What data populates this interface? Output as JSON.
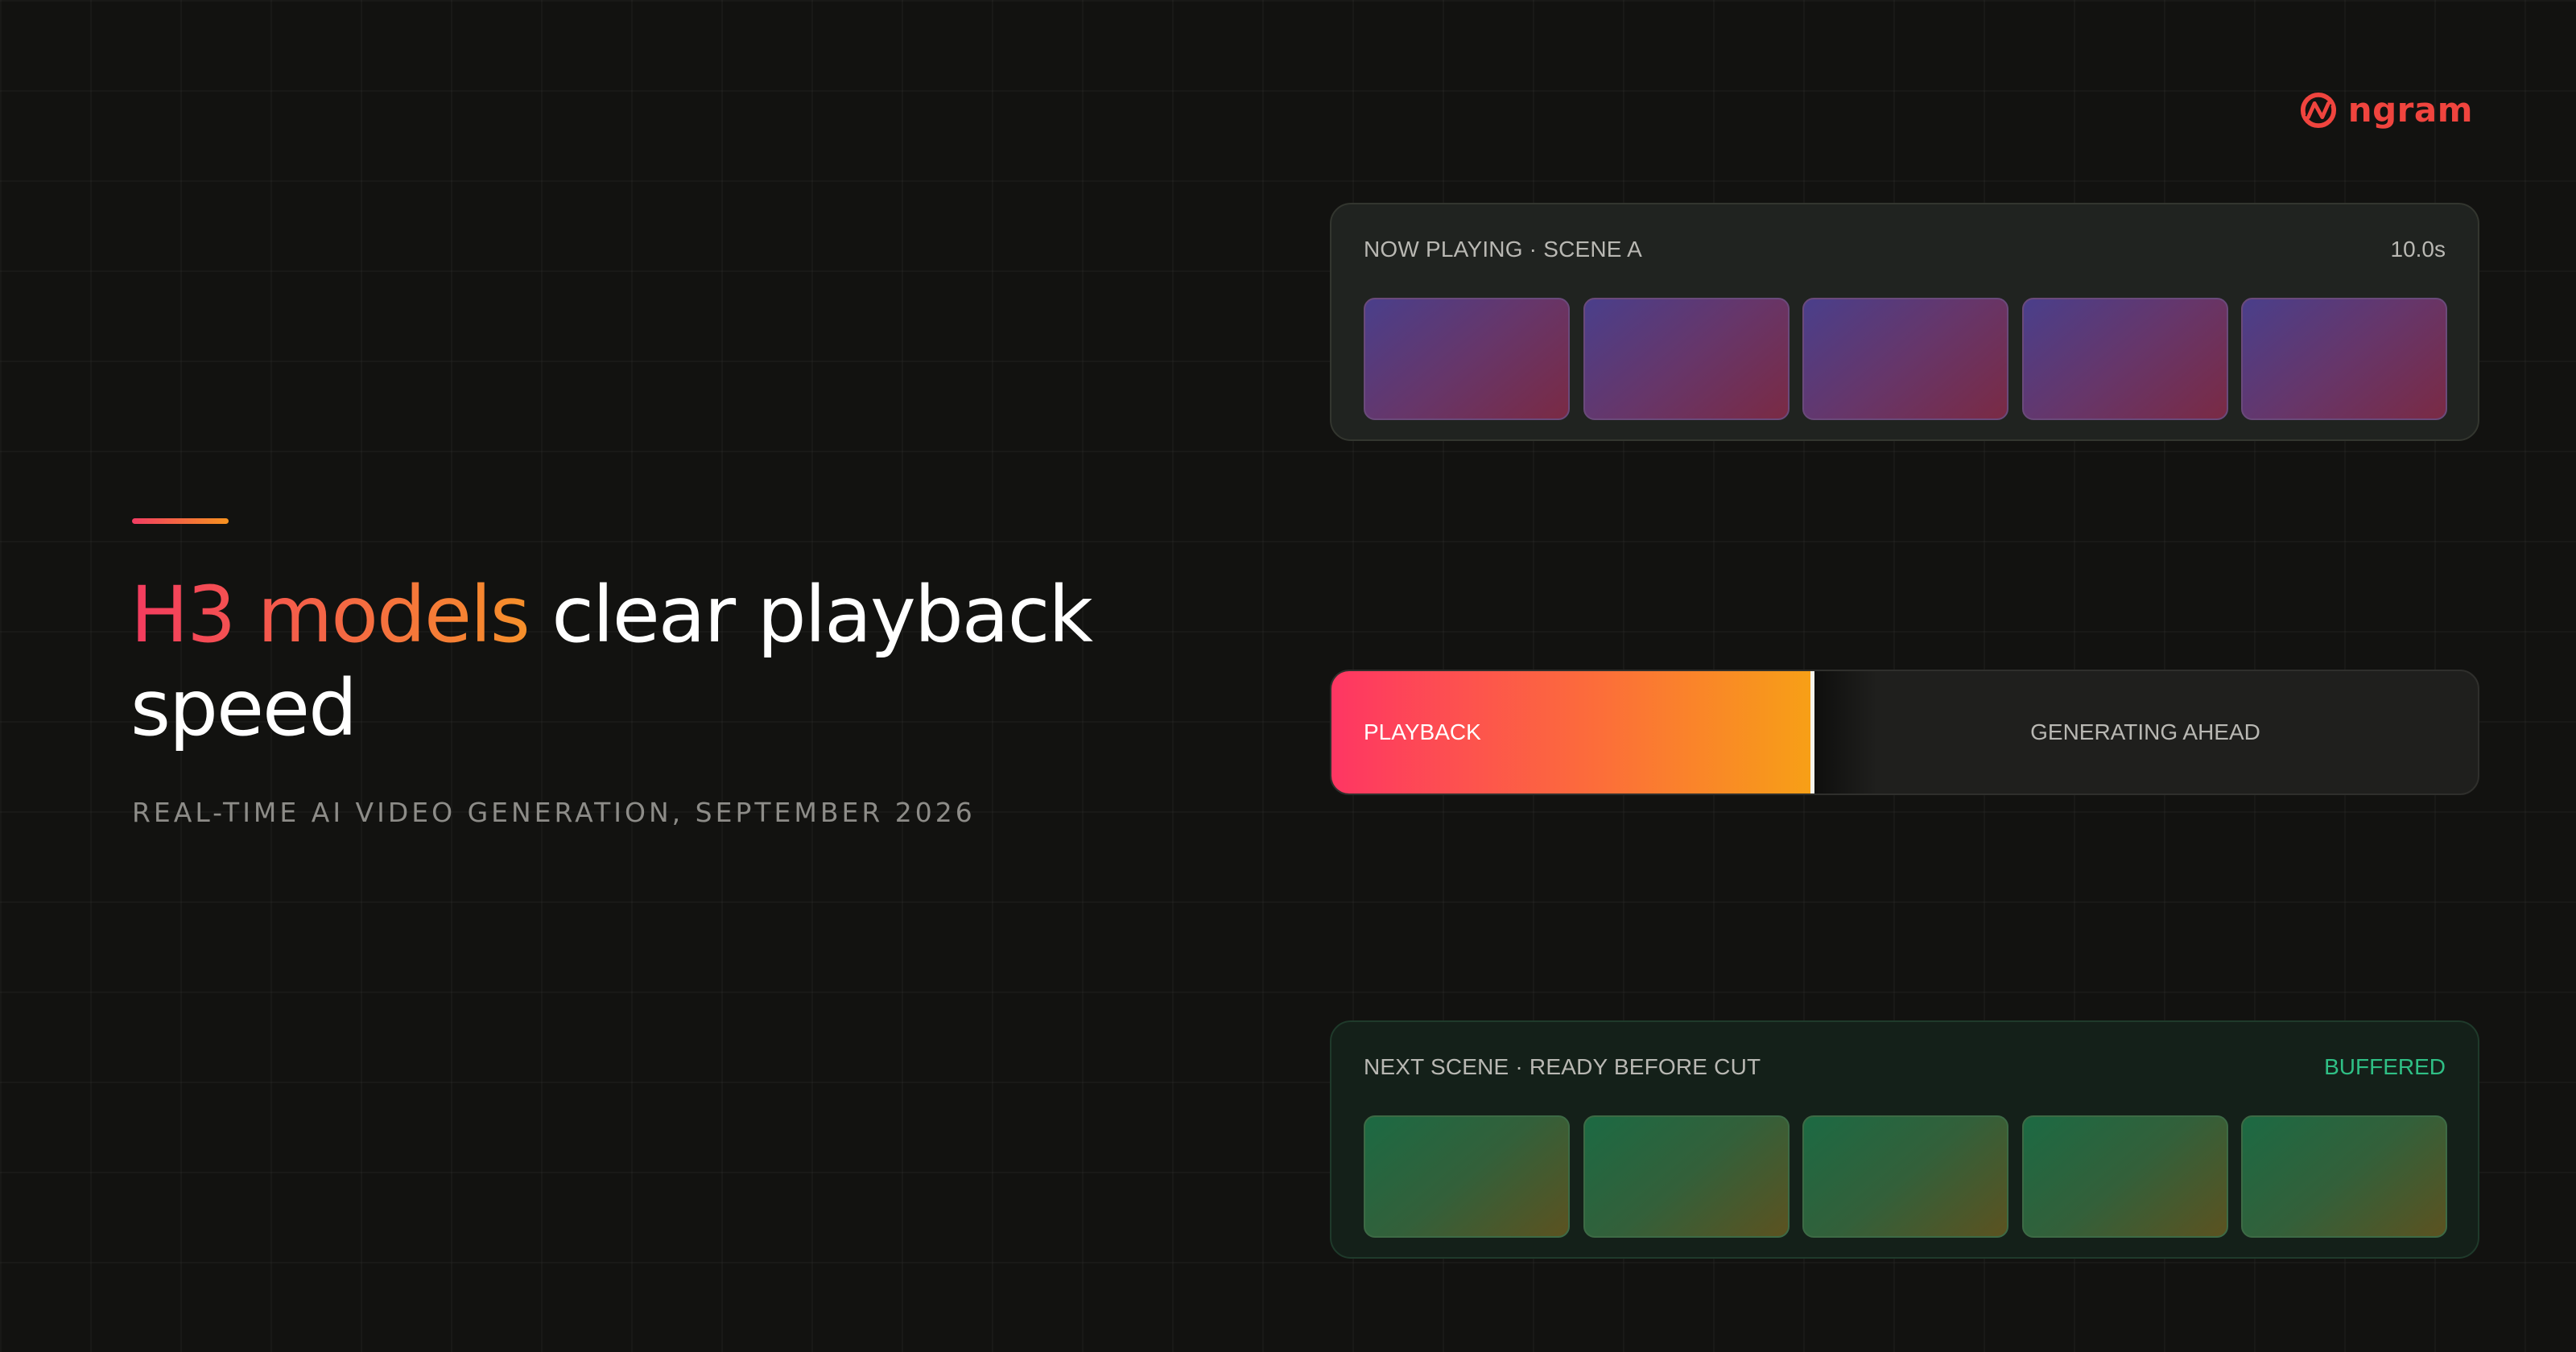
{
  "brand": {
    "name": "ngram",
    "icon": "ngram-logo-icon",
    "color": "#f0443e"
  },
  "hero": {
    "headline_part1": "H3 models",
    "headline_part2": " clear playback speed",
    "subtitle": "REAL-TIME AI VIDEO GENERATION, SEPTEMBER 2026",
    "accent_gradient": [
      "#f23d63",
      "#f6931f"
    ]
  },
  "now_playing": {
    "label": "NOW PLAYING · SCENE A",
    "duration": "10.0s",
    "frame_count": 5
  },
  "playback": {
    "label": "PLAYBACK",
    "ahead_label": "GENERATING AHEAD",
    "progress": 0.42,
    "gradient": [
      "#fe3663",
      "#f7a016"
    ]
  },
  "next_scene": {
    "label": "NEXT SCENE · READY BEFORE CUT",
    "status": "BUFFERED",
    "status_color": "#2fbf85",
    "frame_count": 5
  }
}
